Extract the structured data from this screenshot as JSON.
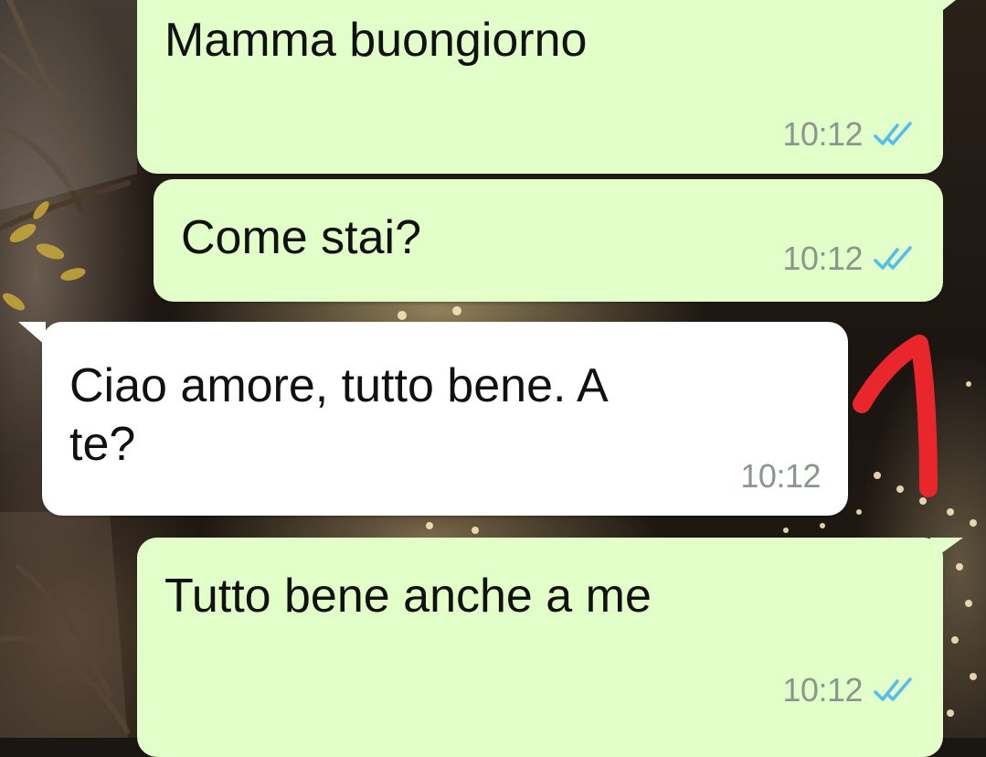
{
  "messages": [
    {
      "id": "m1",
      "direction": "outgoing",
      "text": "Mamma buongiorno",
      "time": "10:12",
      "status": "read"
    },
    {
      "id": "m2",
      "direction": "outgoing",
      "text": "Come stai?",
      "time": "10:12",
      "status": "read"
    },
    {
      "id": "m3",
      "direction": "incoming",
      "text": "Ciao amore, tutto bene. A\nte?",
      "time": "10:12"
    },
    {
      "id": "m4",
      "direction": "outgoing",
      "text": "Tutto bene anche a me",
      "time": "10:12",
      "status": "read"
    }
  ],
  "annotation": {
    "type": "handwritten-mark",
    "color": "#e8262b"
  },
  "colors": {
    "outgoing_bubble": "#e2fec9",
    "incoming_bubble": "#ffffff",
    "read_ticks": "#53bdeb",
    "timestamp": "#8b968f"
  }
}
